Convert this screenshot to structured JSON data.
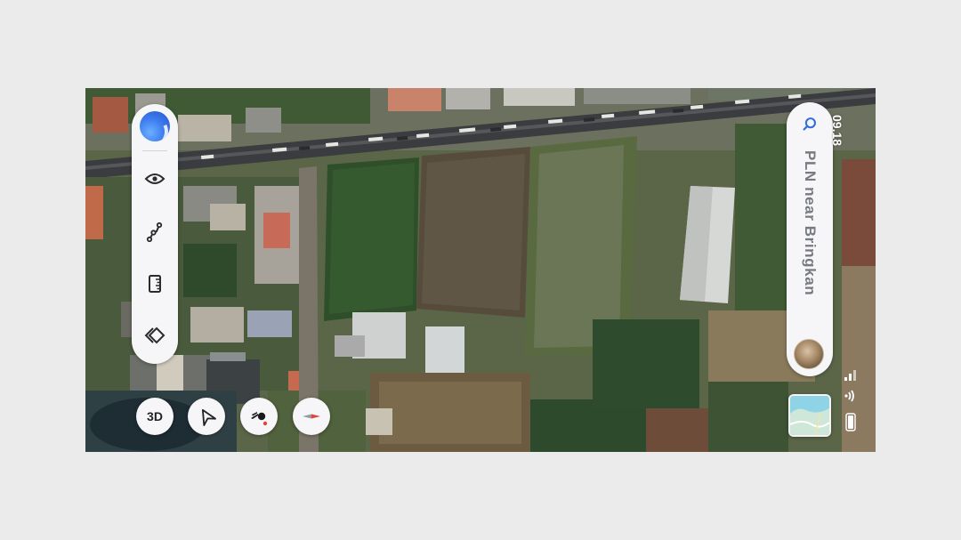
{
  "search": {
    "text": "PLN near Bringkan"
  },
  "status_bar": {
    "time": "09.18"
  },
  "bottom_controls": {
    "three_d_label": "3D"
  },
  "icons": {
    "app_logo": "app-logo-icon",
    "pin": "location-pin-icon",
    "route": "route-icon",
    "ruler": "ruler-icon",
    "layers": "layers-icon",
    "navigate": "navigate-arrow-icon",
    "street_view": "street-view-icon",
    "compass": "compass-icon",
    "search": "search-icon",
    "signal": "signal-icon",
    "wifi": "wifi-icon",
    "battery": "battery-icon"
  },
  "colors": {
    "panel": "#f6f6f8",
    "accent_blue": "#2f6de0",
    "compass_red": "#e0453a",
    "search_text": "#777a80"
  }
}
